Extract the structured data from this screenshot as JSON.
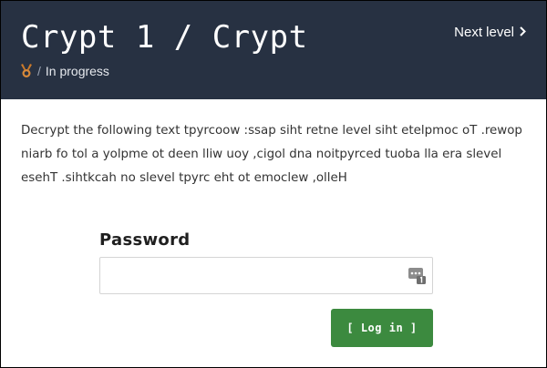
{
  "header": {
    "title": "Crypt 1 / Crypt",
    "status_text": "In progress",
    "status_separator": "/",
    "badge_icon": "medal-icon",
    "next_label": "Next level",
    "next_icon": "chevron-right-icon",
    "background_color": "#273142"
  },
  "main": {
    "instructions": "Decrypt the following text tpyrcoow :ssap siht retne level siht etelpmoc oT .rewop niarb fo tol a yolpme ot deen lliw uoy ,cigol dna noitpyrced tuoba lla era slevel esehT .sihtkcah no slevel tpyrc eht ot emoclew ,olleH"
  },
  "form": {
    "password_label": "Password",
    "password_value": "",
    "password_placeholder": "",
    "password_manager_icon": "password-manager-icon",
    "login_label": "[ Log in ]",
    "login_color": "#3c8a3f"
  }
}
